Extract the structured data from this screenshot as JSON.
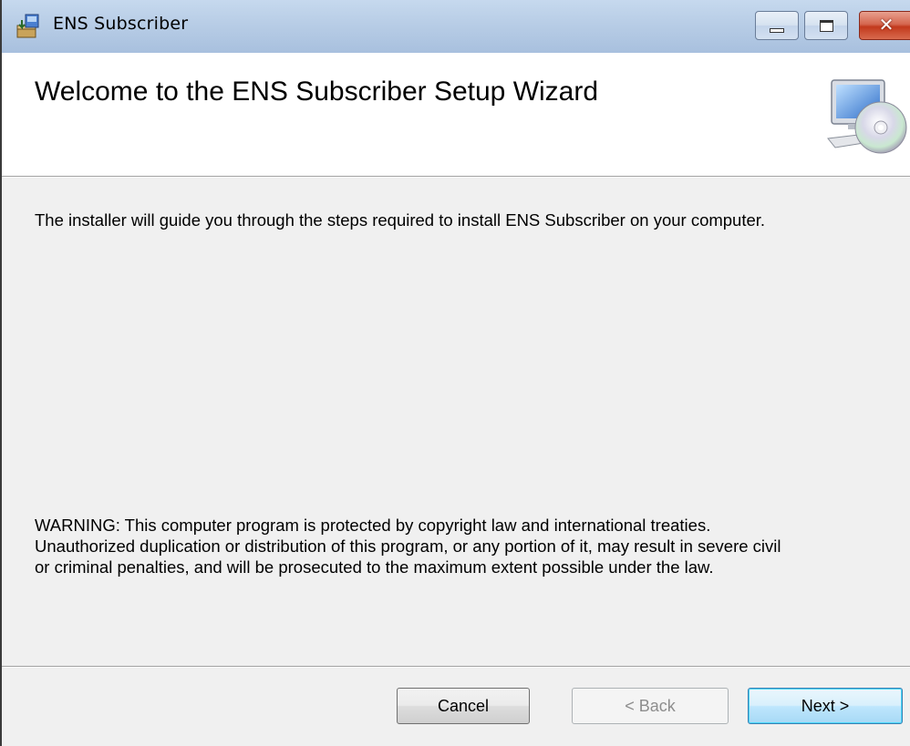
{
  "window": {
    "title": "ENS Subscriber",
    "controls": {
      "minimize_icon": "minimize-icon",
      "maximize_icon": "maximize-icon",
      "close_icon": "close-icon",
      "close_glyph": "✕"
    },
    "title_icon": "installer-icon"
  },
  "banner": {
    "title": "Welcome to the ENS Subscriber Setup Wizard",
    "icon": "computer-cd-icon"
  },
  "body": {
    "intro": "The installer will guide you through the steps required to install ENS Subscriber on your computer.",
    "warning_lines": [
      "WARNING: This computer program is protected by copyright law and international treaties.",
      "Unauthorized duplication or distribution of this program, or any portion of it, may result in severe civil",
      "or criminal penalties, and will be prosecuted to the maximum extent possible under the law."
    ]
  },
  "footer": {
    "cancel_label": "Cancel",
    "back_label": "< Back",
    "next_label": "Next >"
  },
  "colors": {
    "titlebar": "#b8cde6",
    "close_button": "#c2391c",
    "dialog_background": "#f0f0f0",
    "default_button_border": "#3c7fb1"
  }
}
